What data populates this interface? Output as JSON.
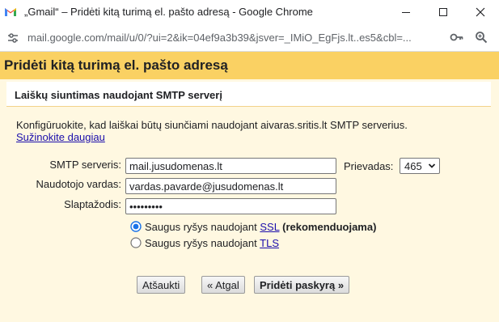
{
  "window": {
    "title": "„Gmail“ – Pridėti kitą turimą el. pašto adresą - Google Chrome",
    "minimize_icon": "minimize-icon",
    "maximize_icon": "maximize-icon",
    "close_icon": "close-icon"
  },
  "urlbar": {
    "url": "mail.google.com/mail/u/0/?ui=2&ik=04ef9a3b39&jsver=_IMiO_EgFjs.lt..es5&cbl=...",
    "icons": [
      "site-settings-icon",
      "key-icon",
      "zoom-icon"
    ]
  },
  "dialog": {
    "title": "Pridėti kitą turimą el. pašto adresą",
    "section_title": "Laiškų siuntimas naudojant SMTP serverį",
    "description": "Konfigūruokite, kad laiškai būtų siunčiami naudojant aivaras.sritis.lt SMTP serverius.",
    "learn_more": "Sužinokite daugiau"
  },
  "form": {
    "smtp_label": "SMTP serveris:",
    "smtp_value": "mail.jusudomenas.lt",
    "port_label": "Prievadas:",
    "port_value": "465",
    "username_label": "Naudotojo vardas:",
    "username_value": "vardas.pavarde@jusudomenas.lt",
    "password_label": "Slaptažodis:",
    "password_value": "•••••••••",
    "ssl_prefix": "Saugus ryšys naudojant",
    "ssl_link": "SSL",
    "ssl_recommended": "(rekomenduojama)",
    "ssl_selected": true,
    "tls_prefix": "Saugus ryšys naudojant",
    "tls_link": "TLS",
    "tls_selected": false
  },
  "buttons": {
    "cancel": "Atšaukti",
    "back": "« Atgal",
    "add": "Pridėti paskyrą »"
  },
  "colors": {
    "header_bg": "#fad163",
    "content_bg": "#fff8e1",
    "link": "#1a0dab"
  }
}
